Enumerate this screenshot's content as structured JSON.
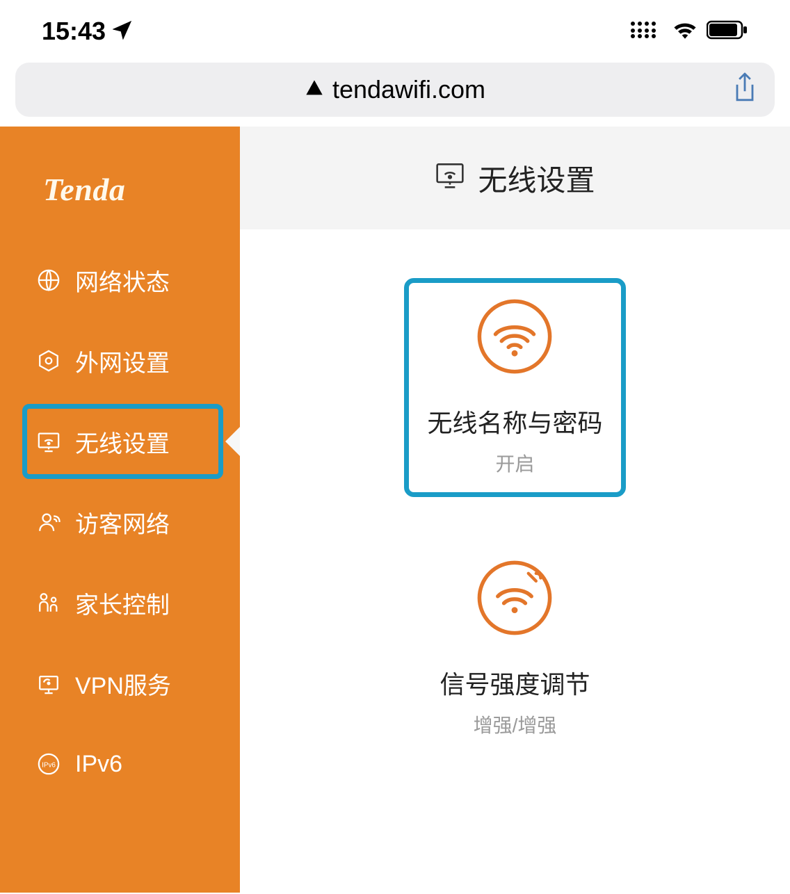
{
  "status": {
    "time": "15:43"
  },
  "browser": {
    "url": "tendawifi.com"
  },
  "sidebar": {
    "logo": "Tenda",
    "items": [
      {
        "label": "网络状态",
        "icon": "globe"
      },
      {
        "label": "外网设置",
        "icon": "hex"
      },
      {
        "label": "无线设置",
        "icon": "wifi-box"
      },
      {
        "label": "访客网络",
        "icon": "guest"
      },
      {
        "label": "家长控制",
        "icon": "parent"
      },
      {
        "label": "VPN服务",
        "icon": "vpn"
      },
      {
        "label": "IPv6",
        "icon": "ipv6"
      }
    ]
  },
  "main": {
    "header": "无线设置",
    "cards": [
      {
        "title": "无线名称与密码",
        "sub": "开启"
      },
      {
        "title": "信号强度调节",
        "sub": "增强/增强"
      }
    ]
  }
}
